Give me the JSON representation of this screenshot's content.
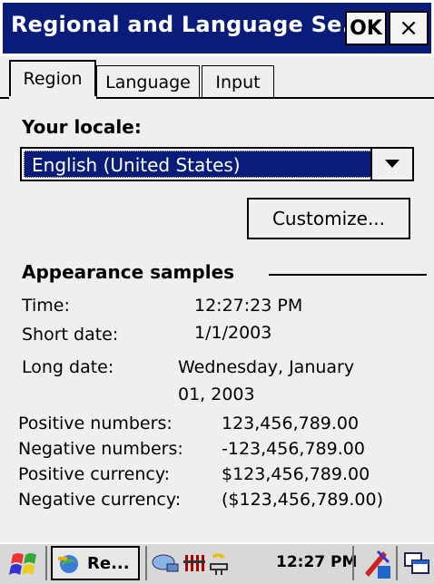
{
  "window": {
    "title": "Regional and Language Se...",
    "ok_label": "OK",
    "close_label": "×"
  },
  "tabs": [
    {
      "label": "Region",
      "active": true
    },
    {
      "label": "Language",
      "active": false
    },
    {
      "label": "Input",
      "active": false
    }
  ],
  "locale": {
    "label": "Your locale:",
    "selected": "English (United States)"
  },
  "customize_label": "Customize...",
  "samples": {
    "heading": "Appearance samples",
    "time_label": "Time:",
    "time_value": "12:27:23 PM",
    "short_date_label": "Short date:",
    "short_date_value": "1/1/2003",
    "long_date_label": "Long date:",
    "long_date_value_line1": "Wednesday, January",
    "long_date_value_line2": "01, 2003",
    "pos_num_label": "Positive numbers:",
    "pos_num_value": "123,456,789.00",
    "neg_num_label": "Negative numbers:",
    "neg_num_value": "-123,456,789.00",
    "pos_cur_label": "Positive currency:",
    "pos_cur_value": "$123,456,789.00",
    "neg_cur_label": "Negative currency:",
    "neg_cur_value": "($123,456,789.00)"
  },
  "taskbar": {
    "task_label": "Re...",
    "clock": "12:27 PM",
    "icons": [
      "start-icon",
      "task-app-icon",
      "network-icon",
      "battery-icon",
      "power-icon",
      "input-panel-icon",
      "desktop-icon"
    ]
  },
  "colors": {
    "titlebar": "#0a1c79",
    "selection": "#0a1c79",
    "panel": "#efefef"
  }
}
